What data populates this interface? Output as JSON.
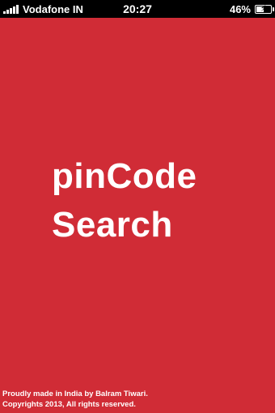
{
  "status_bar": {
    "carrier": "Vodafone IN",
    "time": "20:27",
    "battery": "46%",
    "battery_level": 0.46,
    "signal_icon": "signal-bars-icon",
    "battery_icon": "battery-charging-icon"
  },
  "splash": {
    "title_line1": "pinCode",
    "title_line2": "Search",
    "footer_line1": "Proudly made in India by Balram Tiwari.",
    "footer_line2": "Copyrights 2013, All rights reserved.",
    "background_color": "#d02c36",
    "text_color": "#ffffff"
  }
}
